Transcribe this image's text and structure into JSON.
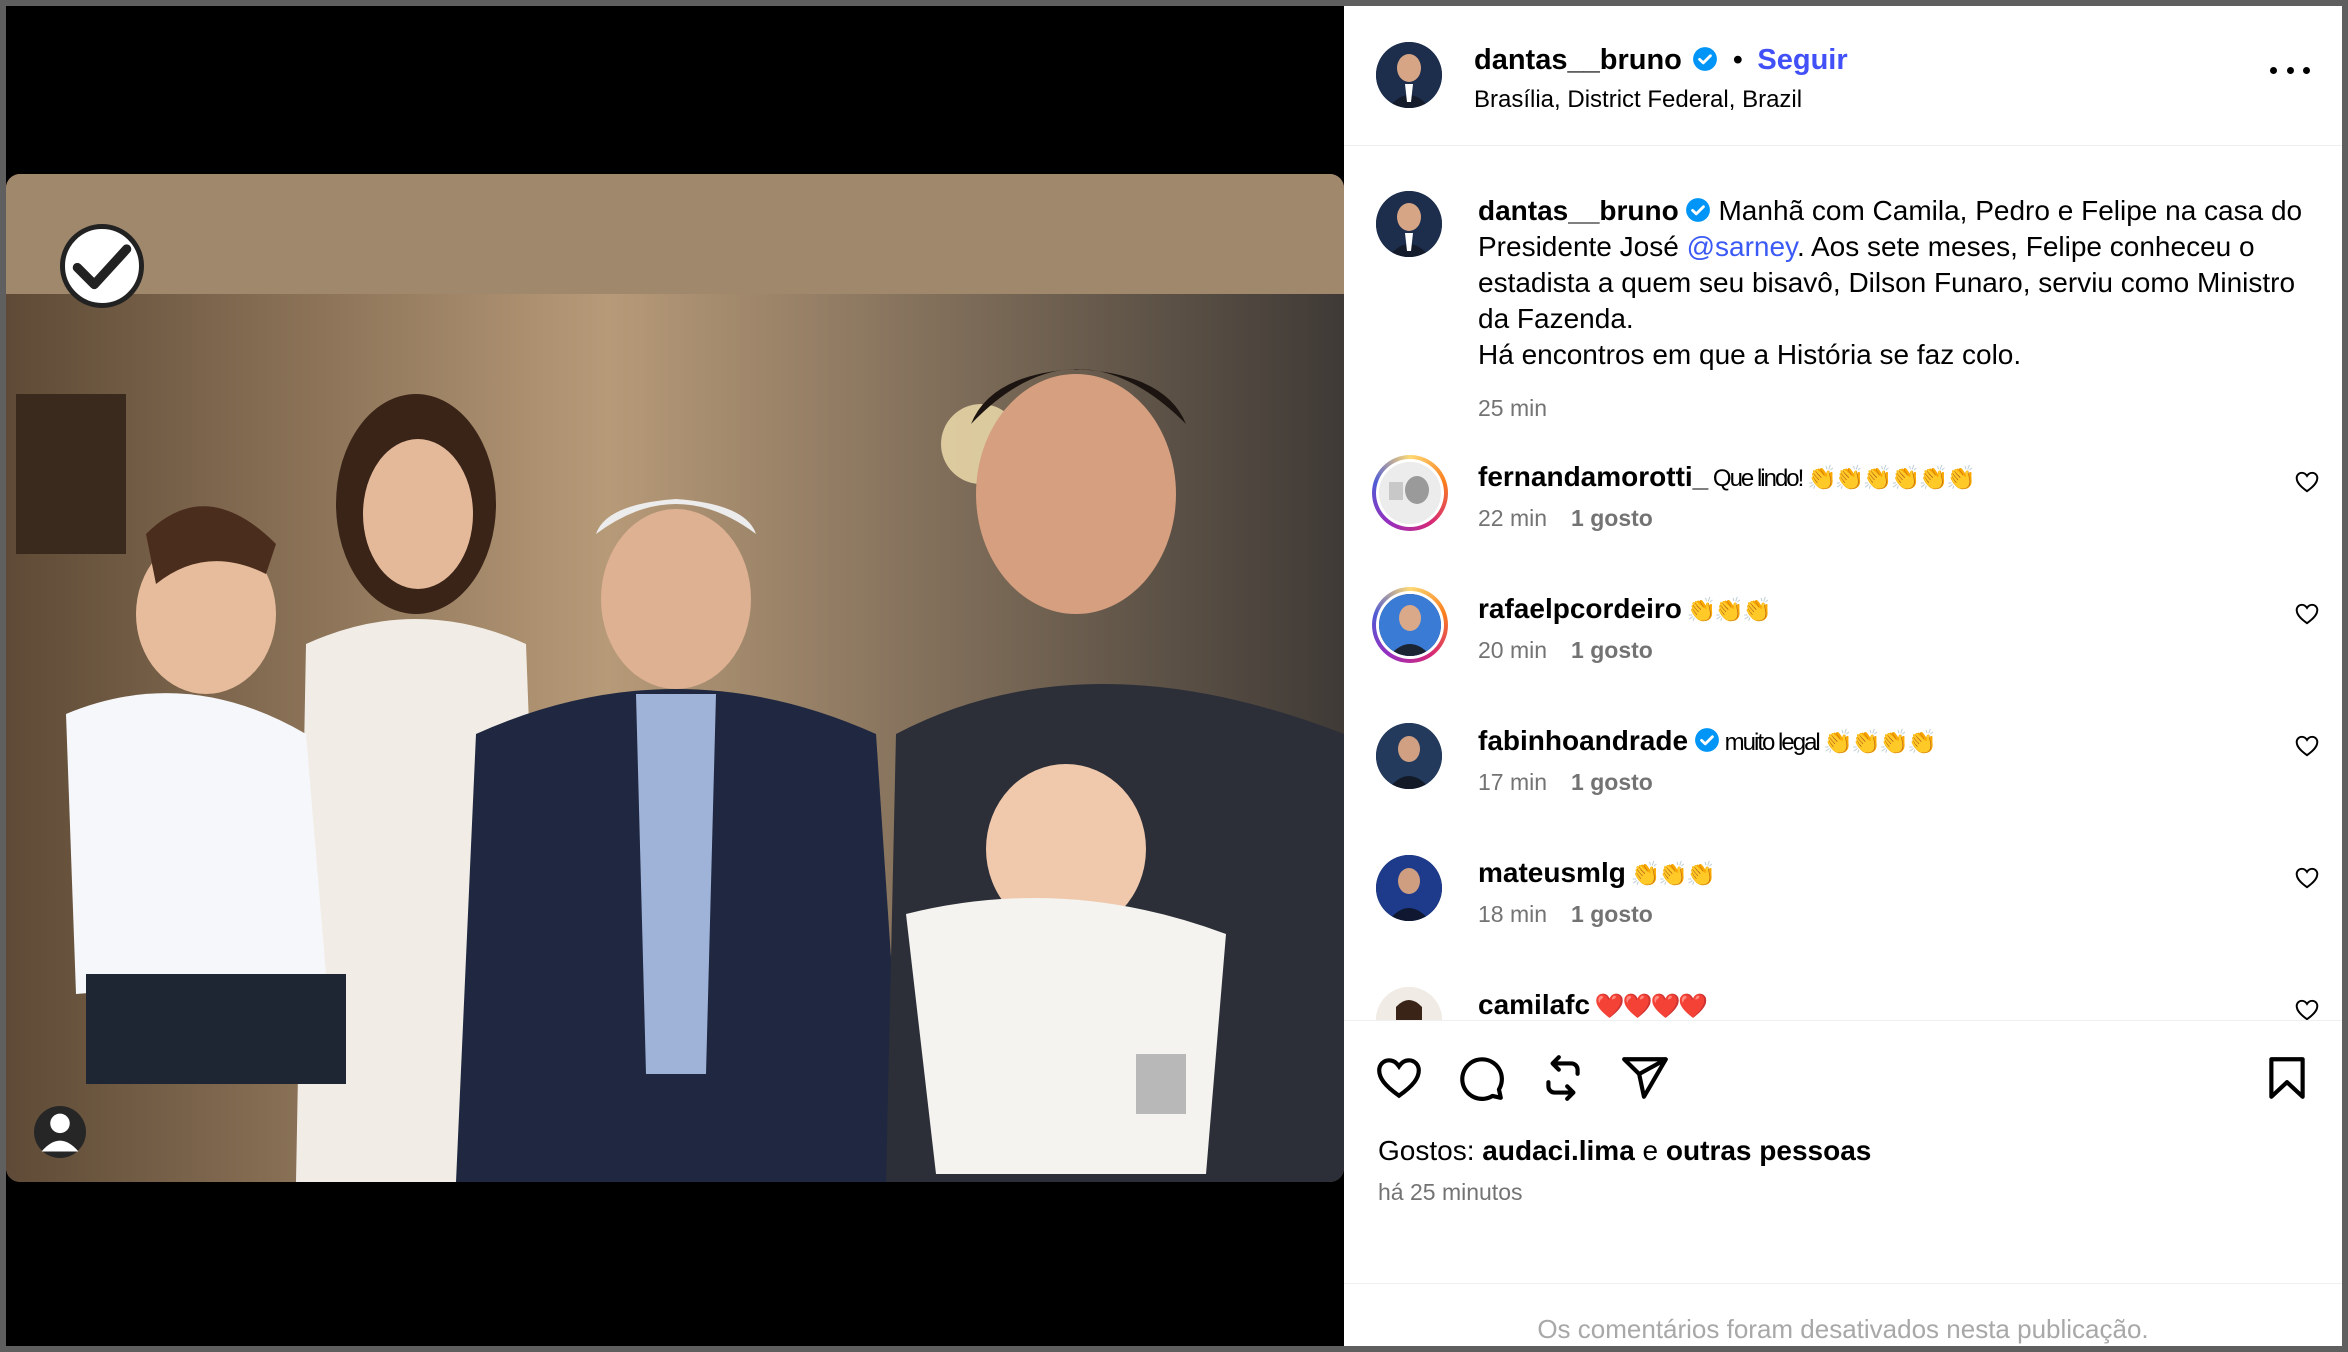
{
  "post": {
    "author": "dantas__bruno",
    "follow_label": "Seguir",
    "dot": "•",
    "location": "Brasília, District Federal, Brazil",
    "caption_part1": " Manhã com Camila, Pedro e Felipe na casa do Presidente José ",
    "caption_mention": "@sarney",
    "caption_part2": ". Aos sete meses, Felipe conheceu o estadista a quem seu bisavô, Dilson Funaro, serviu como Ministro da Fazenda.",
    "caption_line2": "Há encontros em que a História se faz colo.",
    "caption_time": "25 min"
  },
  "comments": [
    {
      "user": "fernandamorotti_",
      "text": " Que lindo! 👏👏👏👏👏👏",
      "time": "22 min",
      "likes": "1 gosto"
    },
    {
      "user": "rafaelpcordeiro",
      "text": " 👏👏👏",
      "time": "20 min",
      "likes": "1 gosto"
    },
    {
      "user": "fabinhoandrade",
      "text": " muito legal 👏👏👏👏",
      "time": "17 min",
      "likes": "1 gosto"
    },
    {
      "user": "mateusmlg",
      "text": " 👏👏👏",
      "time": "18 min",
      "likes": "1 gosto"
    },
    {
      "user": "camilafc",
      "text": " ❤️❤️❤️❤️",
      "time": "",
      "likes": ""
    }
  ],
  "footer": {
    "likes_prefix": "Gostos: ",
    "likes_user": "audaci.lima",
    "likes_conj": " e ",
    "likes_others": "outras pessoas",
    "posted_ago": "há 25 minutos",
    "comments_disabled": "Os comentários foram desativados nesta publicação."
  },
  "icons": {
    "like": "heart-icon",
    "comment": "comment-icon",
    "repost": "repost-icon",
    "share": "share-icon",
    "save": "bookmark-icon",
    "verified": "verified-badge-icon",
    "more": "more-options-icon"
  },
  "colors": {
    "follow": "#4150f7",
    "verified": "#0095f6",
    "meta": "#737373"
  }
}
